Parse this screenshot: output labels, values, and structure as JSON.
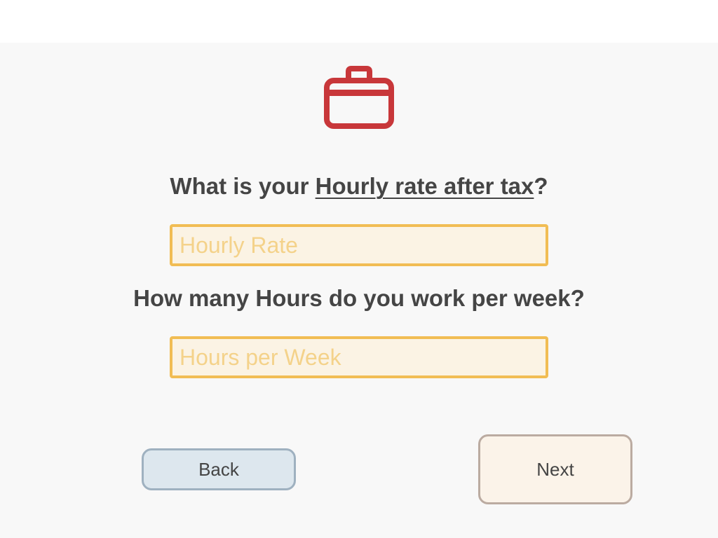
{
  "question1": {
    "prefix": "What is your ",
    "emphasis": "Hourly rate after tax",
    "suffix": "?"
  },
  "hourly_rate_field": {
    "placeholder": "Hourly Rate",
    "value": ""
  },
  "question2": {
    "text": "How many Hours do you work per week?"
  },
  "hours_field": {
    "placeholder": "Hours per Week",
    "value": ""
  },
  "buttons": {
    "back_label": "Back",
    "next_label": "Next"
  },
  "icon": {
    "name": "briefcase-icon"
  },
  "colors": {
    "accent": "#c8373a",
    "field_border": "#f1bd54",
    "field_background": "#fbf3e4",
    "placeholder": "#f4d28a",
    "text": "#454545",
    "back_background": "#dde7ee",
    "next_background": "#fbf3e9"
  }
}
